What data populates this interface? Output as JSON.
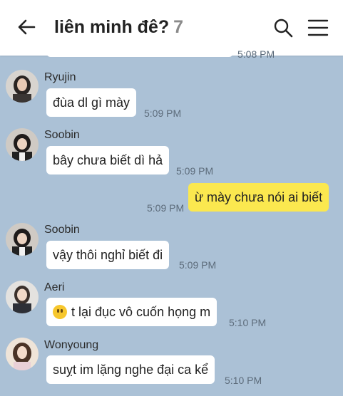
{
  "header": {
    "title": "liên minh đê?",
    "member_count": "7",
    "back_icon": "back-arrow-icon",
    "search_icon": "search-icon",
    "menu_icon": "hamburger-menu-icon"
  },
  "colors": {
    "background": "#abc1d6",
    "own_bubble": "#fbe84f",
    "other_bubble": "#ffffff"
  },
  "messages": [
    {
      "time": "5:08 PM"
    },
    {
      "sender": "Ryujin",
      "text": "đùa dl gì mày",
      "time": "5:09 PM"
    },
    {
      "sender": "Soobin",
      "text": "bây chưa biết dì hả",
      "time": "5:09 PM"
    },
    {
      "sender": "me",
      "text": "ừ mày chưa nói ai biết",
      "time": "5:09 PM"
    },
    {
      "sender": "Soobin",
      "text": "vậy thôi nghỉ biết đi",
      "time": "5:09 PM"
    },
    {
      "sender": "Aeri",
      "emoji": "hugging-face-emoji",
      "text": "t lại đục vô cuốn họng m",
      "time": "5:10 PM"
    },
    {
      "sender": "Wonyoung",
      "text": "suỵt im lặng nghe đại ca kể",
      "time": "5:10 PM"
    }
  ]
}
